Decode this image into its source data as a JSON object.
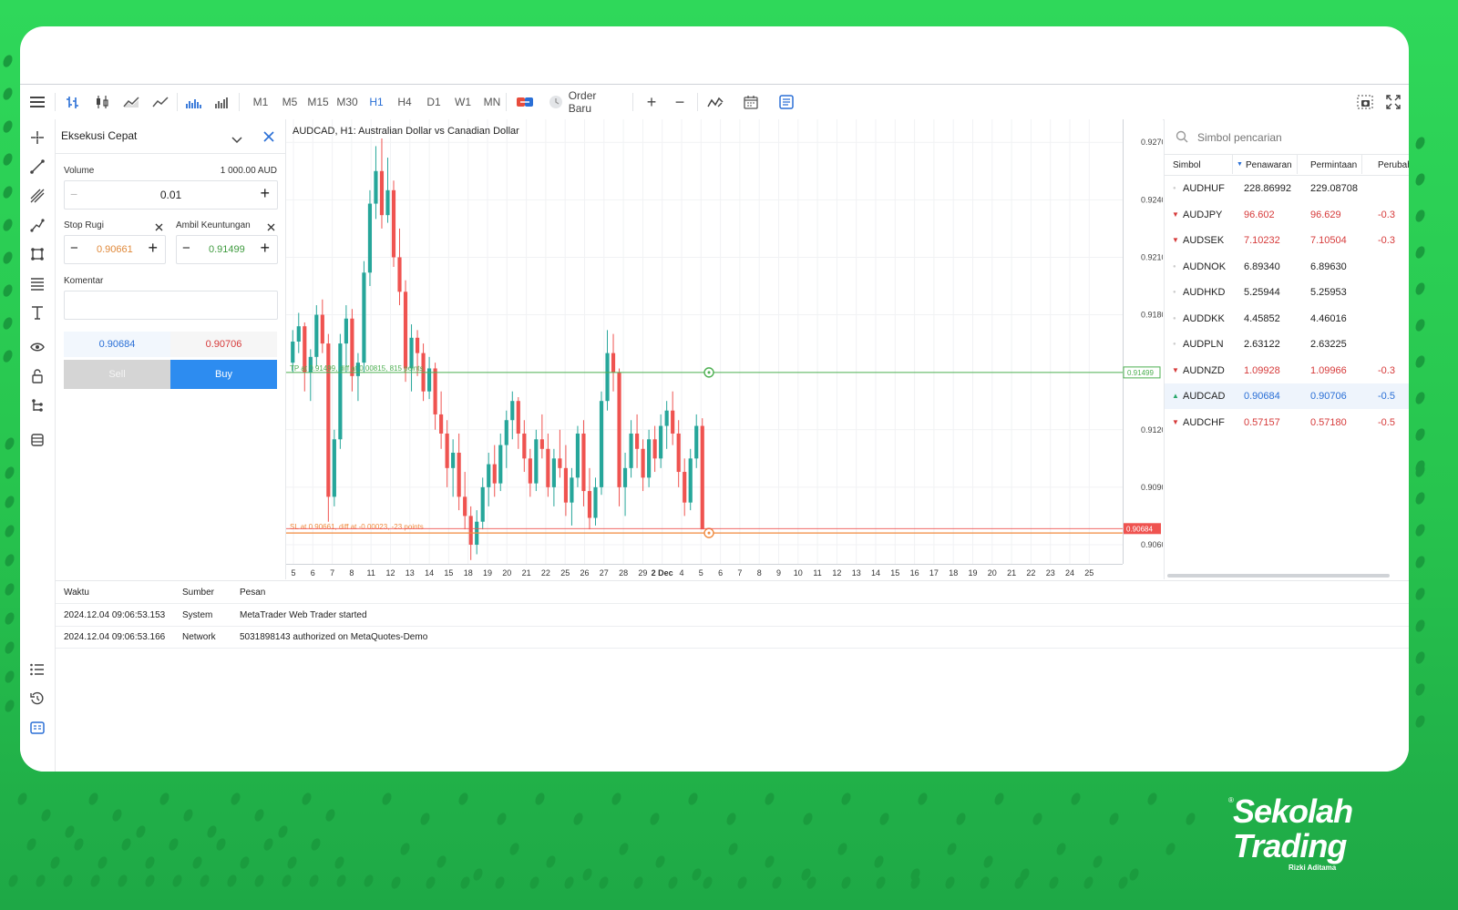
{
  "toolbar": {
    "timeframes": [
      "M1",
      "M5",
      "M15",
      "M30",
      "H1",
      "H4",
      "D1",
      "W1",
      "MN"
    ],
    "active_timeframe": "H1",
    "order_button_label": "Order Baru",
    "plus": "+",
    "minus": "−"
  },
  "trade_panel": {
    "title": "Eksekusi Cepat",
    "volume_label": "Volume",
    "volume_amount": "1 000.00 AUD",
    "volume_value": "0.01",
    "stop_loss_label": "Stop Rugi",
    "stop_loss_value": "0.90661",
    "take_profit_label": "Ambil Keuntungan",
    "take_profit_value": "0.91499",
    "comment_label": "Komentar",
    "bid": "0.90684",
    "ask": "0.90706",
    "sell_label": "Sell",
    "buy_label": "Buy"
  },
  "chart": {
    "title": "AUDCAD, H1: Australian Dollar vs Canadian Dollar",
    "price_ticks": [
      "0.92700",
      "0.92400",
      "0.92100",
      "0.91800",
      "0.91200",
      "0.90900",
      "0.90600"
    ],
    "x_ticks": [
      "5",
      "6",
      "7",
      "8",
      "11",
      "12",
      "13",
      "14",
      "15",
      "18",
      "19",
      "20",
      "21",
      "22",
      "25",
      "26",
      "27",
      "28",
      "29",
      "2 Dec",
      "4",
      "5",
      "6",
      "7",
      "8",
      "9",
      "10",
      "11",
      "12",
      "13",
      "14",
      "15",
      "16",
      "17",
      "18",
      "19",
      "20",
      "21",
      "22",
      "23",
      "24",
      "25"
    ],
    "tp_line_label": "TP at 0.91499, diff at 0.00815, 815 points",
    "sl_line_label": "SL at 0.90661, diff at -0.00023, -23 points",
    "tp_price_tag": "0.91499",
    "current_price_tag": "0.90684",
    "colors": {
      "up": "#26a69a",
      "down": "#ef5350",
      "tp": "#4caf50",
      "sl": "#f08a3e",
      "price": "#ef5350"
    }
  },
  "chart_data": {
    "type": "candlestick",
    "ylim": [
      0.905,
      0.9282
    ],
    "ohlc": [
      [
        0.9155,
        0.9172,
        0.915,
        0.9166
      ],
      [
        0.9166,
        0.9181,
        0.916,
        0.9174
      ],
      [
        0.9174,
        0.9176,
        0.914,
        0.915
      ],
      [
        0.915,
        0.9162,
        0.9135,
        0.9158
      ],
      [
        0.9158,
        0.9185,
        0.9153,
        0.918
      ],
      [
        0.918,
        0.9188,
        0.916,
        0.9165
      ],
      [
        0.9165,
        0.917,
        0.9072,
        0.9085
      ],
      [
        0.9085,
        0.912,
        0.908,
        0.9115
      ],
      [
        0.9115,
        0.917,
        0.911,
        0.9165
      ],
      [
        0.9165,
        0.9185,
        0.915,
        0.9178
      ],
      [
        0.9178,
        0.9183,
        0.914,
        0.9148
      ],
      [
        0.9148,
        0.916,
        0.9135,
        0.9155
      ],
      [
        0.9155,
        0.9208,
        0.915,
        0.9202
      ],
      [
        0.9202,
        0.9245,
        0.9195,
        0.9238
      ],
      [
        0.9238,
        0.9268,
        0.923,
        0.9255
      ],
      [
        0.9255,
        0.9272,
        0.9225,
        0.9232
      ],
      [
        0.9232,
        0.9262,
        0.9228,
        0.9245
      ],
      [
        0.9245,
        0.925,
        0.9205,
        0.921
      ],
      [
        0.921,
        0.9225,
        0.9185,
        0.9192
      ],
      [
        0.9192,
        0.9198,
        0.9145,
        0.9152
      ],
      [
        0.9152,
        0.9175,
        0.914,
        0.9168
      ],
      [
        0.9168,
        0.9172,
        0.9148,
        0.916
      ],
      [
        0.916,
        0.9165,
        0.9135,
        0.914
      ],
      [
        0.914,
        0.9158,
        0.9136,
        0.9152
      ],
      [
        0.9152,
        0.9155,
        0.912,
        0.9128
      ],
      [
        0.9128,
        0.914,
        0.911,
        0.9118
      ],
      [
        0.9118,
        0.9125,
        0.909,
        0.91
      ],
      [
        0.91,
        0.9115,
        0.9085,
        0.9108
      ],
      [
        0.9108,
        0.9118,
        0.9078,
        0.9085
      ],
      [
        0.9085,
        0.9098,
        0.9068,
        0.9075
      ],
      [
        0.9075,
        0.908,
        0.9052,
        0.906
      ],
      [
        0.906,
        0.9078,
        0.9055,
        0.9072
      ],
      [
        0.9072,
        0.9095,
        0.9068,
        0.909
      ],
      [
        0.909,
        0.9108,
        0.908,
        0.9102
      ],
      [
        0.9102,
        0.9112,
        0.9085,
        0.9092
      ],
      [
        0.9092,
        0.9118,
        0.9088,
        0.9112
      ],
      [
        0.9112,
        0.913,
        0.91,
        0.9125
      ],
      [
        0.9125,
        0.914,
        0.9115,
        0.9135
      ],
      [
        0.9135,
        0.9137,
        0.911,
        0.9118
      ],
      [
        0.9118,
        0.9125,
        0.9098,
        0.9105
      ],
      [
        0.9105,
        0.911,
        0.9085,
        0.9092
      ],
      [
        0.9092,
        0.912,
        0.9088,
        0.9115
      ],
      [
        0.9115,
        0.9128,
        0.9105,
        0.911
      ],
      [
        0.911,
        0.9118,
        0.9085,
        0.909
      ],
      [
        0.909,
        0.911,
        0.908,
        0.9105
      ],
      [
        0.9105,
        0.912,
        0.9095,
        0.91
      ],
      [
        0.91,
        0.9112,
        0.9075,
        0.9082
      ],
      [
        0.9082,
        0.91,
        0.907,
        0.9095
      ],
      [
        0.9095,
        0.9122,
        0.909,
        0.9118
      ],
      [
        0.9118,
        0.9125,
        0.908,
        0.9088
      ],
      [
        0.9088,
        0.91,
        0.9068,
        0.9074
      ],
      [
        0.9074,
        0.9095,
        0.907,
        0.909
      ],
      [
        0.909,
        0.914,
        0.9086,
        0.9135
      ],
      [
        0.9135,
        0.9172,
        0.913,
        0.916
      ],
      [
        0.916,
        0.917,
        0.914,
        0.915
      ],
      [
        0.915,
        0.9152,
        0.908,
        0.909
      ],
      [
        0.909,
        0.9108,
        0.9075,
        0.91
      ],
      [
        0.91,
        0.9125,
        0.9095,
        0.9118
      ],
      [
        0.9118,
        0.9128,
        0.91,
        0.911
      ],
      [
        0.911,
        0.9115,
        0.9088,
        0.9095
      ],
      [
        0.9095,
        0.912,
        0.909,
        0.9115
      ],
      [
        0.9115,
        0.9122,
        0.9098,
        0.9105
      ],
      [
        0.9105,
        0.9128,
        0.91,
        0.9122
      ],
      [
        0.9122,
        0.9135,
        0.911,
        0.913
      ],
      [
        0.913,
        0.914,
        0.9112,
        0.9118
      ],
      [
        0.9118,
        0.9125,
        0.909,
        0.9098
      ],
      [
        0.9098,
        0.9105,
        0.9075,
        0.9082
      ],
      [
        0.9082,
        0.911,
        0.9078,
        0.9105
      ],
      [
        0.9105,
        0.9128,
        0.91,
        0.9122
      ],
      [
        0.9122,
        0.9126,
        0.9085,
        0.9068
      ]
    ]
  },
  "watchlist": {
    "search_placeholder": "Simbol pencarian",
    "columns": [
      "Simbol",
      "Penawaran",
      "Permintaan",
      "Perubah"
    ],
    "rows": [
      {
        "symbol": "AUDHUF",
        "bid": "228.86992",
        "ask": "229.08708",
        "change": "",
        "dir": "none"
      },
      {
        "symbol": "AUDJPY",
        "bid": "96.602",
        "ask": "96.629",
        "change": "-0.3",
        "dir": "down"
      },
      {
        "symbol": "AUDSEK",
        "bid": "7.10232",
        "ask": "7.10504",
        "change": "-0.3",
        "dir": "down"
      },
      {
        "symbol": "AUDNOK",
        "bid": "6.89340",
        "ask": "6.89630",
        "change": "",
        "dir": "none"
      },
      {
        "symbol": "AUDHKD",
        "bid": "5.25944",
        "ask": "5.25953",
        "change": "",
        "dir": "none"
      },
      {
        "symbol": "AUDDKK",
        "bid": "4.45852",
        "ask": "4.46016",
        "change": "",
        "dir": "none"
      },
      {
        "symbol": "AUDPLN",
        "bid": "2.63122",
        "ask": "2.63225",
        "change": "",
        "dir": "none"
      },
      {
        "symbol": "AUDNZD",
        "bid": "1.09928",
        "ask": "1.09966",
        "change": "-0.3",
        "dir": "down"
      },
      {
        "symbol": "AUDCAD",
        "bid": "0.90684",
        "ask": "0.90706",
        "change": "-0.5",
        "dir": "up"
      },
      {
        "symbol": "AUDCHF",
        "bid": "0.57157",
        "ask": "0.57180",
        "change": "-0.5",
        "dir": "down"
      }
    ]
  },
  "journal": {
    "headers": [
      "Waktu",
      "Sumber",
      "Pesan"
    ],
    "rows": [
      {
        "time": "2024.12.04 09:06:53.153",
        "source": "System",
        "message": "MetaTrader Web Trader started"
      },
      {
        "time": "2024.12.04 09:06:53.166",
        "source": "Network",
        "message": "5031898143 authorized on MetaQuotes-Demo"
      }
    ]
  },
  "branding": {
    "line1": "Sekolah",
    "line2": "Trading",
    "byline": "Rizki Aditama",
    "reg": "®"
  }
}
